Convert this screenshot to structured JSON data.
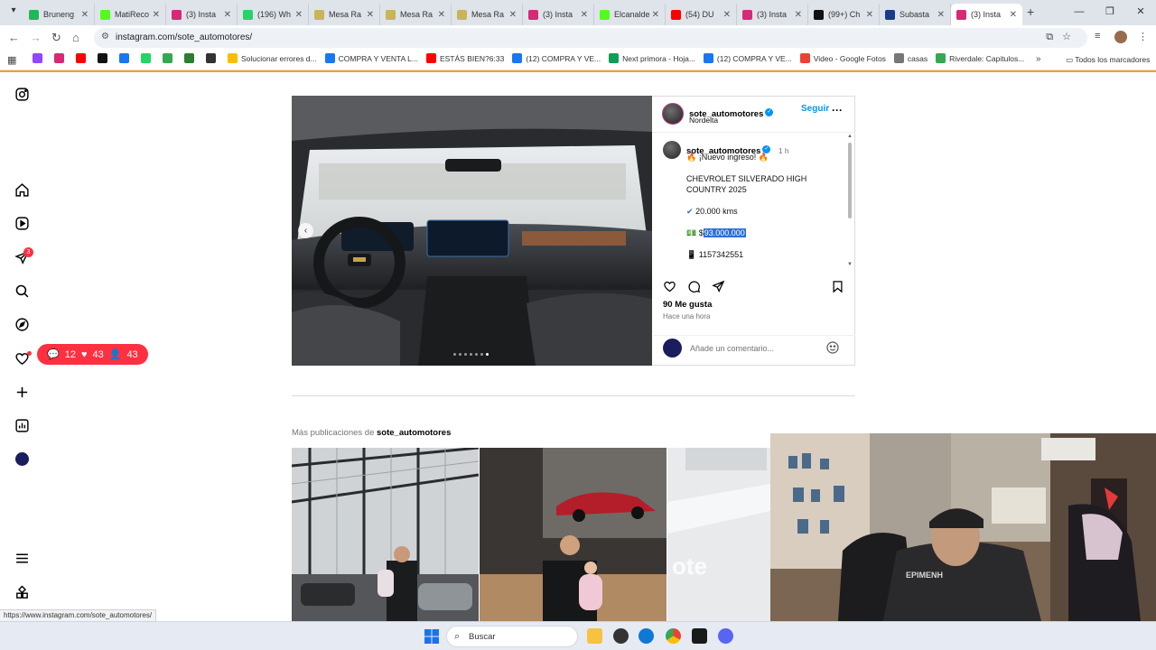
{
  "browser": {
    "tabs": [
      {
        "title": "Bruneng",
        "color": "#1db954"
      },
      {
        "title": "MatiReco",
        "color": "#53fc18"
      },
      {
        "title": "(3) Insta",
        "color": "#d62976"
      },
      {
        "title": "(196) Wh",
        "color": "#25d366"
      },
      {
        "title": "Mesa Ra",
        "color": "#c8b45a"
      },
      {
        "title": "Mesa Ra",
        "color": "#c8b45a"
      },
      {
        "title": "Mesa Ra",
        "color": "#c8b45a"
      },
      {
        "title": "(3) Insta",
        "color": "#d62976"
      },
      {
        "title": "Elcanalde",
        "color": "#53fc18"
      },
      {
        "title": "(54) DU",
        "color": "#ff0000"
      },
      {
        "title": "(3) Insta",
        "color": "#d62976"
      },
      {
        "title": "(99+) Ch",
        "color": "#111111"
      },
      {
        "title": "Subasta",
        "color": "#1b3a8a"
      },
      {
        "title": "(3) Insta",
        "color": "#d62976",
        "active": true
      }
    ],
    "url": "instagram.com/sote_automotores/",
    "bookmarks": [
      {
        "label": "",
        "color": "#9146ff"
      },
      {
        "label": "",
        "color": "#d62976"
      },
      {
        "label": "",
        "color": "#ff0000"
      },
      {
        "label": "",
        "color": "#111111"
      },
      {
        "label": "",
        "color": "#1877f2"
      },
      {
        "label": "",
        "color": "#25d366"
      },
      {
        "label": "",
        "color": "#34a853"
      },
      {
        "label": "",
        "color": "#2e7d32"
      },
      {
        "label": "",
        "color": "#333333"
      },
      {
        "label": "Solucionar errores d...",
        "color": "#fbbc05"
      },
      {
        "label": "COMPRA Y VENTA L...",
        "color": "#1877f2"
      },
      {
        "label": "ESTÁS BIEN?6:33",
        "color": "#ff0000"
      },
      {
        "label": "(12) COMPRA Y VE...",
        "color": "#1877f2"
      },
      {
        "label": "Next primora - Hoja...",
        "color": "#0f9d58"
      },
      {
        "label": "(12) COMPRA Y VE...",
        "color": "#1877f2"
      },
      {
        "label": "Video - Google Fotos",
        "color": "#ea4335"
      },
      {
        "label": "casas",
        "color": "#777777"
      },
      {
        "label": "Riverdale: Capitulos...",
        "color": "#34a853"
      }
    ],
    "all_bookmarks": "Todos los marcadores",
    "status_url": "https://www.instagram.com/sote_automotores/"
  },
  "rail": {
    "notif_count": "3"
  },
  "activity": {
    "comments": "12",
    "likes": "43",
    "follows": "43"
  },
  "post": {
    "username": "sote_automotores",
    "location": "Nordelta",
    "follow": "Seguir",
    "time": "1 h",
    "caption_line1": "¡Nuevo ingreso!",
    "caption_model": "CHEVROLET SILVERADO HIGH COUNTRY 2025",
    "km": "20.000 kms",
    "price_symbol": "$",
    "price": "93.000.000",
    "phone": "1157342551",
    "likes": "90 Me gusta",
    "posted": "Hace una hora",
    "comment_placeholder": "Añade un comentario...",
    "carousel_dots": 7,
    "carousel_active": 6
  },
  "more": {
    "prefix": "Más publicaciones de",
    "user": "sote_automotores"
  },
  "taskbar": {
    "search": "Buscar"
  }
}
